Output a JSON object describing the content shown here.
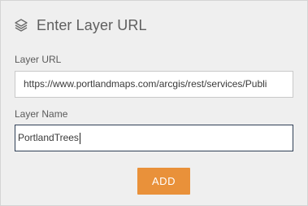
{
  "dialog": {
    "title": "Enter Layer URL",
    "icon": "layers-icon"
  },
  "fields": {
    "url": {
      "label": "Layer URL",
      "value": "https://www.portlandmaps.com/arcgis/rest/services/Publi"
    },
    "name": {
      "label": "Layer Name",
      "value": "PortlandTrees"
    }
  },
  "actions": {
    "add_label": "ADD",
    "add_color": "#e9913a"
  }
}
